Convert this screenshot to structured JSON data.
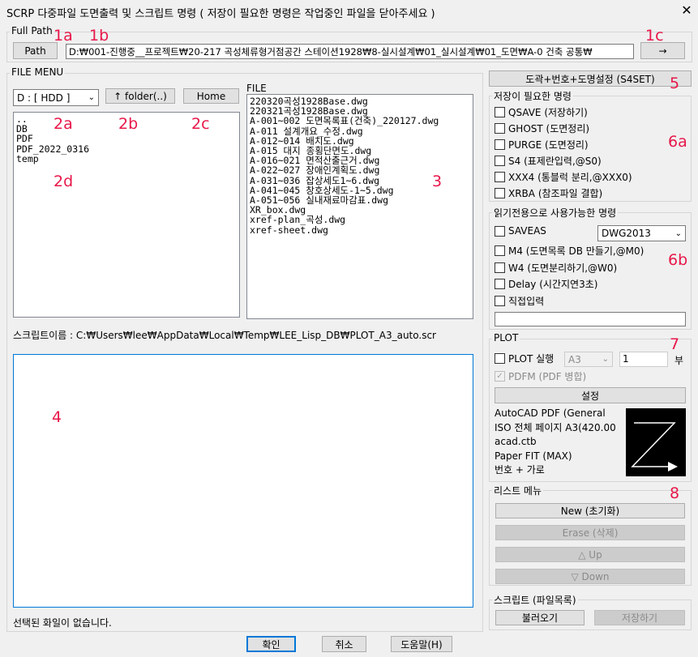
{
  "window": {
    "title": "SCRP 다중파일 도면출력 및 스크립트 명령  ( 저장이 필요한 명령은 작업중인 파일을 닫아주세요 )",
    "close_glyph": "✕"
  },
  "full_path": {
    "legend": "Full Path",
    "path_button": "Path",
    "path_value": "D:₩001-진행중__프로젝트₩20-217 곡성체류형거점공간 스테이션1928₩8-실시설계₩01_실시설계₩01_도면₩A-0 건축 공통₩",
    "go_button": "→"
  },
  "file_menu": {
    "legend": "FILE MENU",
    "drive_value": "D : [ HDD ]",
    "folder_up_button": "↑ folder(..)",
    "home_button": "Home",
    "folders": [
      "..",
      "DB",
      "PDF",
      "PDF_2022_0316",
      "temp"
    ]
  },
  "file_list": {
    "label": "FILE",
    "files": [
      "220320곡성1928Base.dwg",
      "220321곡성1928Base.dwg",
      "A-001~002 도면목록표(건축)_220127.dwg",
      "A-011 설계개요_수정.dwg",
      "A-012~014 배치도.dwg",
      "A-015 대지 종횡단면도.dwg",
      "A-016~021 면적산출근거.dwg",
      "A-022~027 장애인계획도.dwg",
      "A-031~036 잡상세도1~6.dwg",
      "A-041~045 창호상세도-1~5.dwg",
      "A-051~056 실내재료마감표.dwg",
      "XR_box.dwg",
      "xref-plan_곡성.dwg",
      "xref-sheet.dwg"
    ]
  },
  "script": {
    "name_label": "스크립트이름 : C:₩Users₩lee₩AppData₩Local₩Temp₩LEE_Lisp_DB₩PLOT_A3_auto.scr",
    "status": "선택된 화일이 없습니다."
  },
  "right": {
    "s4set_button": "도곽+번호+도명설정 (S4SET)",
    "save_group": {
      "legend": "저장이 필요한 명령",
      "items": [
        "QSAVE (저장하기)",
        "GHOST (도면정리)",
        "PURGE (도면정리)",
        "S4   (표제란입력,@S0)",
        "XXX4 (통블럭 분리,@XXX0)",
        "XRBA (참조파일 결합)"
      ]
    },
    "read_group": {
      "legend": "읽기전용으로 사용가능한 명령",
      "saveas": "SAVEAS",
      "dwg_version": "DWG2013",
      "items": [
        "M4  (도면목록 DB 만들기,@M0)",
        "W4  (도면분리하기,@W0)",
        "Delay (시간지연3초)",
        "직접입력"
      ]
    },
    "plot_group": {
      "legend": "PLOT",
      "plot_run": "PLOT 실행",
      "paper": "A3",
      "copies": "1",
      "copies_unit": "부",
      "pdfm": "PDFM (PDF 병합)",
      "settings_button": "설정",
      "info": [
        "AutoCAD PDF (General",
        "ISO 전체 페이지 A3(420.00",
        "acad.ctb",
        "Paper FIT (MAX)",
        "번호 + 가로"
      ]
    },
    "list_menu": {
      "legend": "리스트 메뉴",
      "new_button": "New (초기화)",
      "erase_button": "Erase (삭제)",
      "up_button": "△ Up",
      "down_button": "▽ Down"
    },
    "script_group": {
      "legend": "스크립트 (파일목록)",
      "load_button": "불러오기",
      "save_button": "저장하기"
    }
  },
  "footer": {
    "ok_button": "확인",
    "cancel_button": "취소",
    "help_button": "도움말(H)"
  },
  "annotations": {
    "a1a": "1a",
    "a1b": "1b",
    "a1c": "1c",
    "a2a": "2a",
    "a2b": "2b",
    "a2c": "2c",
    "a2d": "2d",
    "a3": "3",
    "a4": "4",
    "a5": "5",
    "a6a": "6a",
    "a6b": "6b",
    "a7": "7",
    "a8": "8"
  },
  "colors": {
    "annotation": "#e8174a",
    "focus_border": "#0078d7"
  }
}
